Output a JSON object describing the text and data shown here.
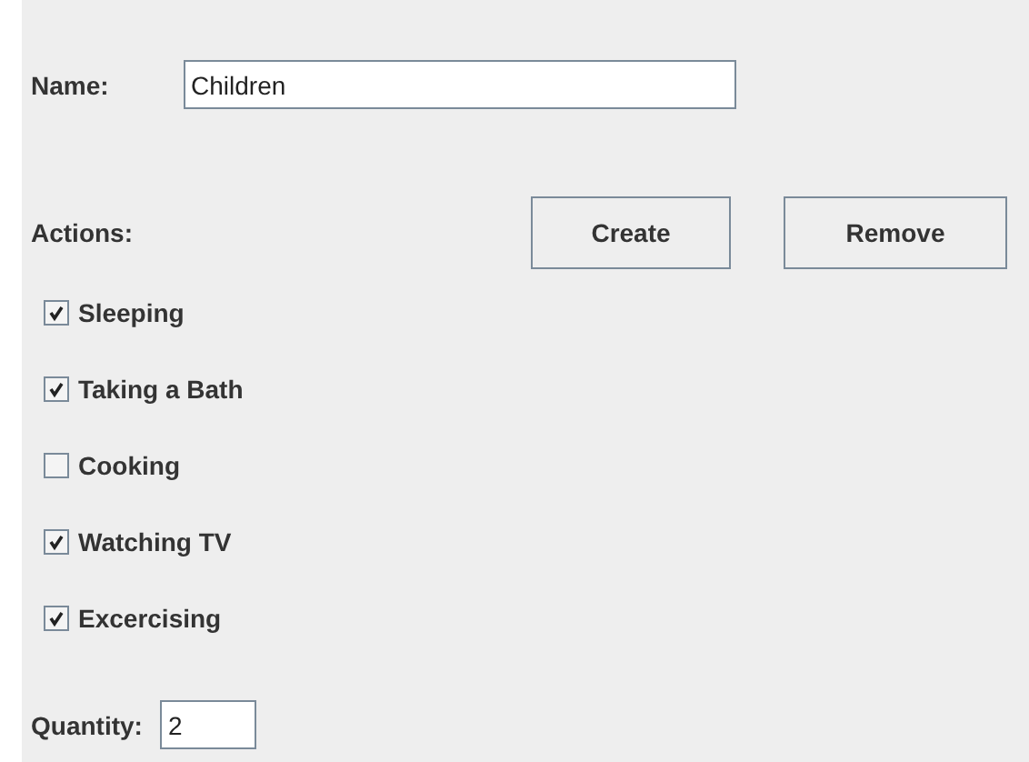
{
  "name_field": {
    "label": "Name:",
    "value": "Children"
  },
  "actions": {
    "label": "Actions:",
    "buttons": [
      "Create",
      "Remove"
    ]
  },
  "checkboxes": [
    {
      "label": "Sleeping",
      "checked": true
    },
    {
      "label": "Taking a Bath",
      "checked": true
    },
    {
      "label": "Cooking",
      "checked": false
    },
    {
      "label": "Watching TV",
      "checked": true
    },
    {
      "label": "Excercising",
      "checked": true
    }
  ],
  "quantity": {
    "label": "Quantity:",
    "value": "2"
  }
}
